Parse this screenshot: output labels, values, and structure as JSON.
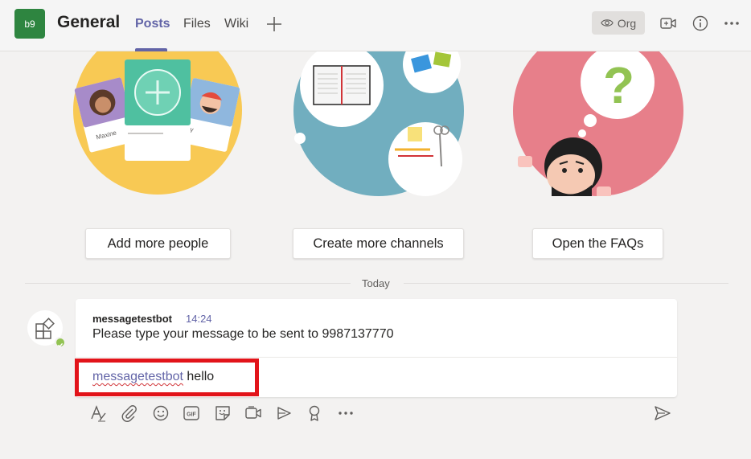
{
  "header": {
    "team_initials": "b9",
    "channel_name": "General",
    "tabs": [
      {
        "label": "Posts",
        "active": true
      },
      {
        "label": "Files",
        "active": false
      },
      {
        "label": "Wiki",
        "active": false
      }
    ],
    "org_label": "Org",
    "icons": [
      "add-tab-icon",
      "eye-icon",
      "meet-now-icon",
      "info-icon",
      "more-options-icon"
    ]
  },
  "illustrations": {
    "people_card_names": [
      "Maxine",
      "ky"
    ],
    "colors": {
      "people": "#f8c954",
      "channels": "#71aebf",
      "faqs": "#e77f8a"
    }
  },
  "actions": {
    "add_people": "Add more people",
    "create_channels": "Create more channels",
    "open_faqs": "Open the FAQs"
  },
  "divider": {
    "label": "Today"
  },
  "message": {
    "author": "messagetestbot",
    "time": "14:24",
    "text": "Please type your message to be sent to 9987137770",
    "presence": "available"
  },
  "compose": {
    "mention": "messagetestbot",
    "text": " hello"
  },
  "toolbar": {
    "icons": [
      "format-icon",
      "attach-icon",
      "emoji-icon",
      "gif-icon",
      "sticker-icon",
      "meet-icon",
      "stream-icon",
      "praise-icon",
      "more-icon",
      "send-icon"
    ]
  },
  "colors": {
    "accent": "#6264a7",
    "highlight": "#e2141a",
    "team_avatar": "#2e8540"
  }
}
